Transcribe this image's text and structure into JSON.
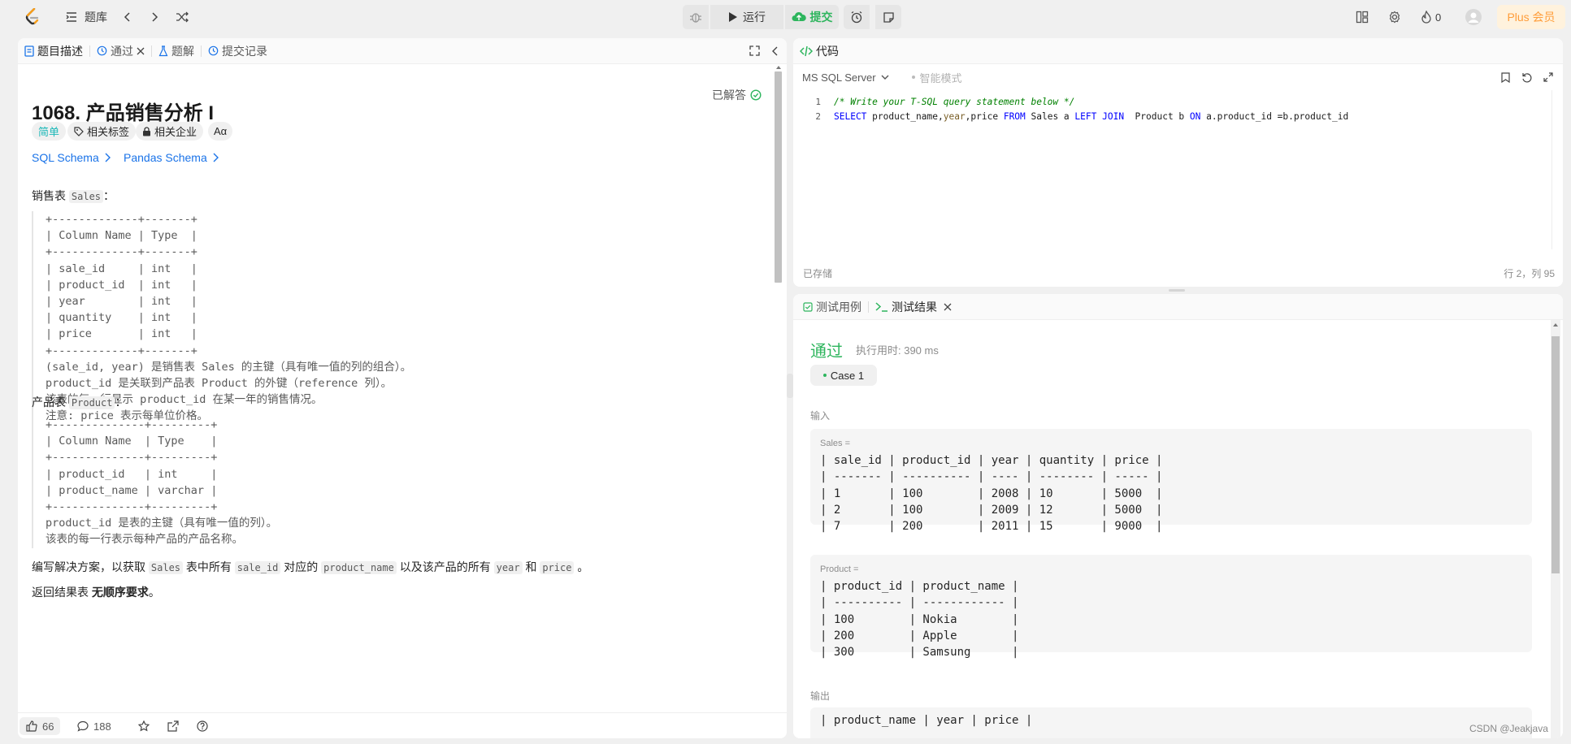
{
  "topnav": {
    "problem_list_label": "题库",
    "run_label": "运行",
    "submit_label": "提交",
    "streak_count": "0",
    "plus_label": "Plus 会员"
  },
  "left": {
    "tabs": [
      "题目描述",
      "通过",
      "题解",
      "提交记录"
    ],
    "title": "1068. 产品销售分析 I",
    "status": "已解答",
    "tags": [
      "简单",
      "相关标签",
      "相关企业",
      "Aα"
    ],
    "schema_links": [
      "SQL Schema",
      "Pandas Schema"
    ],
    "sales_intro_label": "销售表",
    "sales_intro_code": "Sales",
    "sales_table": "+-------------+-------+\n| Column Name | Type  |\n+-------------+-------+\n| sale_id     | int   |\n| product_id  | int   |\n| year        | int   |\n| quantity    | int   |\n| price       | int   |\n+-------------+-------+\n(sale_id, year) 是销售表 Sales 的主键（具有唯一值的列的组合）。\nproduct_id 是关联到产品表 Product 的外键（reference 列）。\n该表的每一行显示 product_id 在某一年的销售情况。\n注意: price 表示每单位价格。",
    "product_intro_label": "产品表",
    "product_intro_code": "Product",
    "product_table": "+--------------+---------+\n| Column Name  | Type    |\n+--------------+---------+\n| product_id   | int     |\n| product_name | varchar |\n+--------------+---------+\nproduct_id 是表的主键（具有唯一值的列）。\n该表的每一行表示每种产品的产品名称。",
    "task_parts": [
      "编写解决方案，以获取",
      "Sales",
      "表中所有",
      "sale_id",
      "对应的",
      "product_name",
      "以及该产品的所有",
      "year",
      "和",
      "price",
      "。"
    ],
    "order_text_a": "返回结果表",
    "order_text_b": "无顺序要求",
    "order_text_c": "。",
    "likes": "66",
    "comments": "188"
  },
  "code": {
    "tab_label": "代码",
    "language": "MS SQL Server",
    "mode": "智能模式",
    "lines": [
      "/* Write your T-SQL query statement below */",
      "SELECT product_name,year,price FROM Sales a LEFT JOIN  Product b ON a.product_id =b.product_id"
    ],
    "line_numbers": [
      "1",
      "2"
    ],
    "saved": "已存储",
    "cursor": "行 2，列 95"
  },
  "result": {
    "tabs": [
      "测试用例",
      "测试结果"
    ],
    "status": "通过",
    "runtime": "执行用时: 390 ms",
    "case_label": "Case 1",
    "input_label": "输入",
    "sales_var": "Sales =",
    "sales_table": "| sale_id | product_id | year | quantity | price |\n| ------- | ---------- | ---- | -------- | ----- |\n| 1       | 100        | 2008 | 10       | 5000  |\n| 2       | 100        | 2009 | 12       | 5000  |\n| 7       | 200        | 2011 | 15       | 9000  |",
    "product_var": "Product =",
    "product_table": "| product_id | product_name |\n| ---------- | ------------ |\n| 100        | Nokia        |\n| 200        | Apple        |\n| 300        | Samsung      |",
    "output_label": "输出",
    "output_table": "| product_name | year | price |"
  },
  "watermark": "CSDN @Jeakjava"
}
